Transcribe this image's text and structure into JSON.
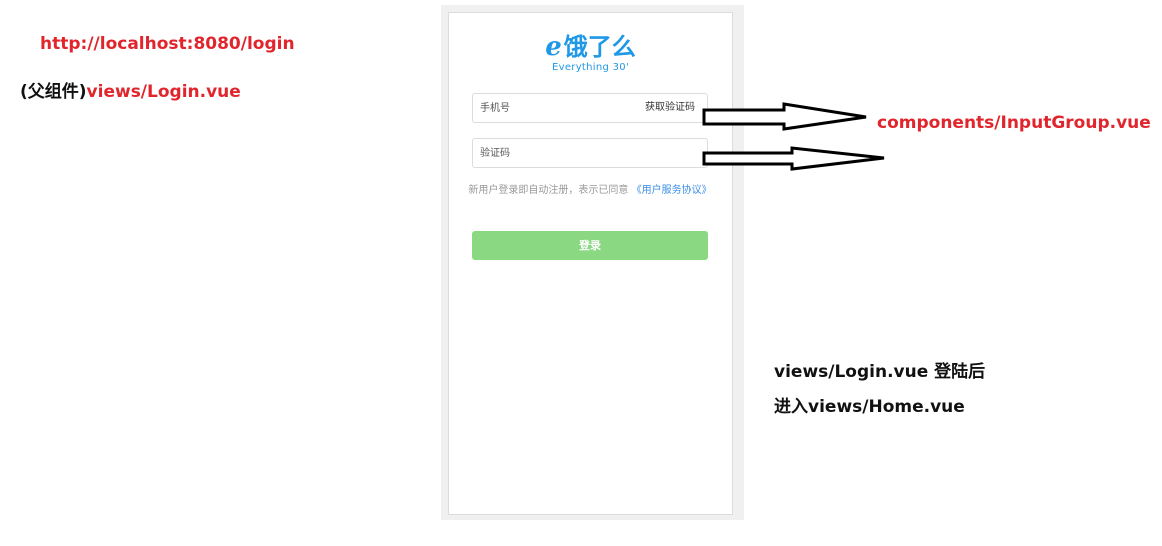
{
  "annotations": {
    "url": "http://localhost:8080/login",
    "parent_prefix": "(父组件)",
    "parent_file": "views/Login.vue",
    "component": "components/InputGroup.vue",
    "after_login_1": "views/Login.vue 登陆后",
    "after_login_2": "进入views/Home.vue"
  },
  "logo": {
    "brand": "饿了么",
    "tagline": "Everything 30'"
  },
  "form": {
    "phone_placeholder": "手机号",
    "get_code_label": "获取验证码",
    "code_placeholder": "验证码",
    "agreement_text": "新用户登录即自动注册，表示已同意",
    "agreement_link": "《用户服务协议》",
    "login_label": "登录"
  },
  "colors": {
    "annotation_red": "#e0262c",
    "brand_blue": "#1f98e6",
    "login_button_green": "#8ad882",
    "link_blue": "#3b8ee6"
  },
  "icons": [
    "elm-logo-icon",
    "arrow-right-icon"
  ]
}
